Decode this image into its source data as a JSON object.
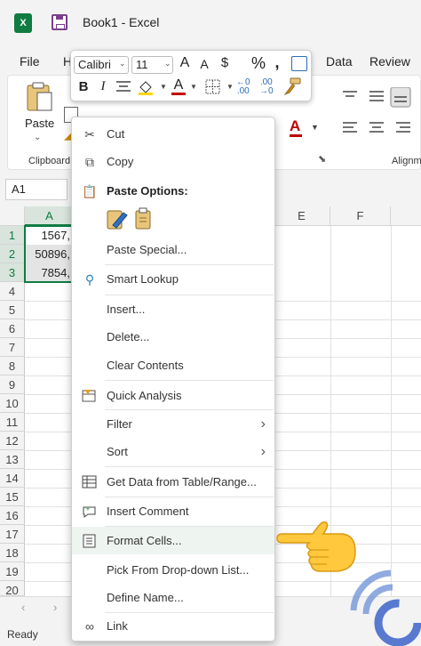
{
  "window": {
    "title": "Book1  -  Excel"
  },
  "menu_tabs": [
    "File",
    "H",
    "Data",
    "Review"
  ],
  "ribbon": {
    "paste_label": "Paste",
    "groups": [
      "Clipboard",
      "Alignm"
    ]
  },
  "name_box": "A1",
  "columns": [
    "A",
    "E",
    "F"
  ],
  "rows": [
    "1",
    "2",
    "3",
    "4",
    "5",
    "6",
    "7",
    "8",
    "9",
    "10",
    "11",
    "12",
    "13",
    "14",
    "15",
    "16",
    "17",
    "18",
    "19",
    "20"
  ],
  "cells": [
    "1567,",
    "50896,",
    "7854,"
  ],
  "mini_toolbar": {
    "font": "Calibri",
    "size": "11",
    "buttons": [
      "B",
      "I"
    ]
  },
  "context_menu": {
    "cut": "Cut",
    "copy": "Copy",
    "paste_options": "Paste Options:",
    "paste_special": "Paste Special...",
    "smart_lookup": "Smart Lookup",
    "insert": "Insert...",
    "delete": "Delete...",
    "clear_contents": "Clear Contents",
    "quick_analysis": "Quick Analysis",
    "filter": "Filter",
    "sort": "Sort",
    "get_data": "Get Data from Table/Range...",
    "insert_comment": "Insert Comment",
    "format_cells": "Format Cells...",
    "pick_dropdown": "Pick From Drop-down List...",
    "define_name": "Define Name...",
    "link": "Link"
  },
  "status": "Ready",
  "colors": {
    "excel_green": "#107c41",
    "highlight": "#eef4ef",
    "accent_red": "#c00000",
    "fill_yellow": "#ffd400"
  },
  "icons": [
    "excel-logo-icon",
    "save-icon",
    "cut-icon",
    "copy-icon",
    "paste-icon",
    "paste-values-icon",
    "search-icon",
    "quick-analysis-icon",
    "table-icon",
    "comment-icon",
    "format-cells-icon",
    "link-icon",
    "chevron-right-icon",
    "pointing-hand-icon"
  ]
}
